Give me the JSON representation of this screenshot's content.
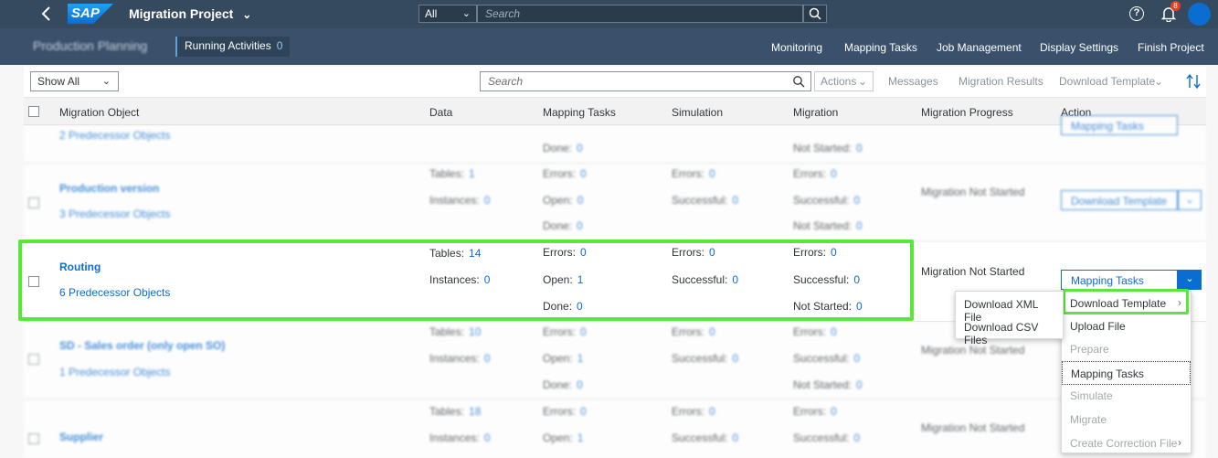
{
  "shell": {
    "logo_text": "SAP",
    "title": "Migration Project",
    "scope_value": "All",
    "search_placeholder": "Search",
    "notifications_count": "8"
  },
  "subheader": {
    "app_title": "Production Planning",
    "running_label": "Running Activities",
    "running_count": "0",
    "nav": [
      "Monitoring",
      "Mapping Tasks",
      "Job Management",
      "Display Settings",
      "Finish Project"
    ]
  },
  "toolbar": {
    "filter_value": "Show All",
    "search_placeholder": "Search",
    "actions_label": "Actions",
    "messages_label": "Messages",
    "migration_results_label": "Migration Results",
    "download_template_label": "Download Template"
  },
  "table": {
    "headers": [
      "Migration Object",
      "Data",
      "Mapping Tasks",
      "Simulation",
      "Migration",
      "Migration Progress",
      "Action"
    ],
    "labels": {
      "tables": "Tables:",
      "instances": "Instances:",
      "errors": "Errors:",
      "open": "Open:",
      "done": "Done:",
      "successful": "Successful:",
      "not_started": "Not Started:"
    },
    "rows": [
      {
        "name": "",
        "predecessors": "2 Predecessor Objects",
        "tables": "",
        "instances": "",
        "map_errors": "",
        "map_open": "",
        "map_done": "0",
        "sim_errors": "",
        "sim_success": "",
        "mig_errors": "",
        "mig_success": "",
        "mig_not_started": "0",
        "progress": "",
        "action": "Mapping Tasks"
      },
      {
        "name": "Production version",
        "predecessors": "3 Predecessor Objects",
        "tables": "1",
        "instances": "0",
        "map_errors": "0",
        "map_open": "0",
        "map_done": "0",
        "sim_errors": "0",
        "sim_success": "0",
        "mig_errors": "0",
        "mig_success": "0",
        "mig_not_started": "0",
        "progress": "Migration Not Started",
        "action": "Download Template"
      },
      {
        "name": "Routing",
        "predecessors": "6 Predecessor Objects",
        "tables": "14",
        "instances": "0",
        "map_errors": "0",
        "map_open": "1",
        "map_done": "0",
        "sim_errors": "0",
        "sim_success": "0",
        "mig_errors": "0",
        "mig_success": "0",
        "mig_not_started": "0",
        "progress": "Migration Not Started",
        "action": "Mapping Tasks"
      },
      {
        "name": "SD - Sales order (only open SO)",
        "predecessors": "1 Predecessor Objects",
        "tables": "10",
        "instances": "0",
        "map_errors": "0",
        "map_open": "1",
        "map_done": "0",
        "sim_errors": "0",
        "sim_success": "0",
        "mig_errors": "0",
        "mig_success": "0",
        "mig_not_started": "0",
        "progress": "Migration Not Started",
        "action": ""
      },
      {
        "name": "Supplier",
        "predecessors": "",
        "tables": "18",
        "instances": "0",
        "map_errors": "0",
        "map_open": "1",
        "map_done": "",
        "sim_errors": "0",
        "sim_success": "0",
        "mig_errors": "0",
        "mig_success": "0",
        "mig_not_started": "",
        "progress": "Migration Not Started",
        "action": ""
      }
    ]
  },
  "action_menu": {
    "items": [
      "Download Template",
      "Upload File",
      "Prepare",
      "Mapping Tasks",
      "Simulate",
      "Migrate",
      "Create Correction File"
    ]
  },
  "submenu": {
    "items": [
      "Download XML File",
      "Download CSV Files"
    ]
  },
  "colors": {
    "shell": "#354a5f",
    "accent": "#0a6ed1",
    "highlight": "#5ae63a"
  }
}
